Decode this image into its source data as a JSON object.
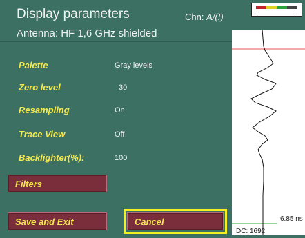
{
  "header": {
    "title": "Display parameters",
    "chn_label": "Chn:",
    "chn_value": "A/(!)",
    "antenna": "Antenna: HF 1,6 GHz shielded"
  },
  "params": [
    {
      "label": "Palette",
      "value": "Gray levels"
    },
    {
      "label": "Zero level",
      "value": "30"
    },
    {
      "label": "Resampling",
      "value": "On"
    },
    {
      "label": "Trace View",
      "value": "Off"
    },
    {
      "label": "Backlighter(%):",
      "value": "100"
    }
  ],
  "buttons": {
    "filters": "Filters",
    "save_exit": "Save and Exit",
    "cancel": "Cancel"
  },
  "trace": {
    "time_label": "6.85 ns",
    "dc_label": "DC: 1692"
  },
  "colors": {
    "background": "#3b7063",
    "button": "#7a2d3b",
    "accent": "#f4e84c",
    "focus": "#f6ef1f",
    "zero_line": "#e05555",
    "time_line": "#2faa2f"
  },
  "icons": {
    "indicator": "signal-level-indicator-icon"
  }
}
